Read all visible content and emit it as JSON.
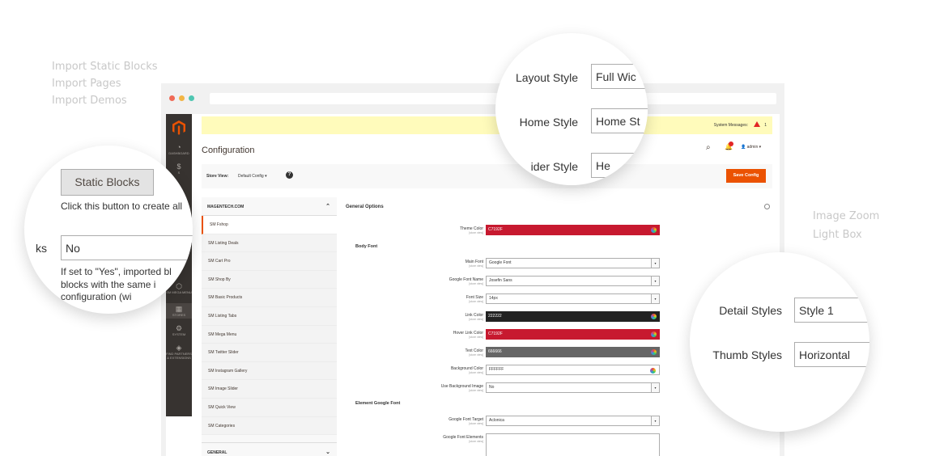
{
  "left_features": [
    "Import Static Blocks",
    "Import Pages",
    "Import Demos"
  ],
  "right_features": [
    "Image Zoom",
    "Light Box"
  ],
  "colors": {
    "accent": "#eb5202",
    "sidebar": "#373330",
    "message_bar": "#fffbbb",
    "theme_color": "#C7192F",
    "link_color": "#222222",
    "text_color": "#666666",
    "background_color": "#FFFFFF"
  },
  "window_dots": [
    "#f06a56",
    "#f2b544",
    "#4fc6b1"
  ],
  "admin_nav": [
    {
      "icon": "speedometer-icon",
      "glyph": "◔",
      "label": "DASHBOARD"
    },
    {
      "icon": "dollar-icon",
      "glyph": "$",
      "label": "S"
    },
    {
      "icon": "hexagon-icon",
      "glyph": "⬡",
      "label": "SM MEGA MENU"
    },
    {
      "icon": "store-icon",
      "glyph": "▦",
      "label": "STORES"
    },
    {
      "icon": "gear-icon",
      "glyph": "⚙",
      "label": "SYSTEM"
    },
    {
      "icon": "cube-icon",
      "glyph": "◈",
      "label": "FIND PARTNERS & EXTENSIONS"
    }
  ],
  "system_messages": {
    "label": "System Messages:",
    "count": "1"
  },
  "header": {
    "title": "Configuration",
    "user": "admin ▾"
  },
  "store_view": {
    "label": "Store View:",
    "value": "Default Config ▾",
    "help": "?",
    "save": "Save Config"
  },
  "config_tabs": {
    "group": "MAGENTECH.COM",
    "items": [
      "SM Fshop",
      "SM Listing Deals",
      "SM Cart Pro",
      "SM Shop By",
      "SM Basic Products",
      "SM Listing Tabs",
      "SM Mega Menu",
      "SM Twitter Slider",
      "SM Instagram Gallery",
      "SM Image Slider",
      "SM Quick View",
      "SM Categories"
    ],
    "bottom_group": "GENERAL"
  },
  "general_options": {
    "title": "General Options",
    "scope": "[store view]",
    "theme_color": {
      "label": "Theme Color",
      "value": "C7192F"
    },
    "body_font_title": "Body Font",
    "fields": [
      {
        "label": "Main Font",
        "value": "Google Font"
      },
      {
        "label": "Google Font Name",
        "value": "Josefin Sans"
      },
      {
        "label": "Font Size",
        "value": "14px"
      },
      {
        "label": "Link Color",
        "value": "222222"
      },
      {
        "label": "Hover Link Color",
        "value": "C7192F"
      },
      {
        "label": "Text Color",
        "value": "666666"
      },
      {
        "label": "Background Color",
        "value": "FFFFFF"
      },
      {
        "label": "Use Background Image",
        "value": "No"
      }
    ],
    "element_font_title": "Element Google Font",
    "font_target": {
      "label": "Google Font Target",
      "value": "Aclonica"
    },
    "font_elements": {
      "label": "Google Font Elements",
      "value": ""
    }
  },
  "zoom_left": {
    "button": "Static Blocks",
    "note": "Click this button to create all",
    "field_label": "ks",
    "field_value": "No",
    "help_lines": [
      "If set to \"Yes\", imported bl",
      "blocks with the same i",
      "configuration (wi"
    ]
  },
  "zoom_top": {
    "fields": [
      {
        "label": "Layout Style",
        "value": "Full Wic"
      },
      {
        "label": "Home Style",
        "value": "Home St"
      },
      {
        "label": "ider Style",
        "value": "He"
      }
    ]
  },
  "zoom_right": {
    "fields": [
      {
        "label": "Detail Styles",
        "value": "Style 1"
      },
      {
        "label": "Thumb Styles",
        "value": "Horizontal"
      }
    ]
  }
}
